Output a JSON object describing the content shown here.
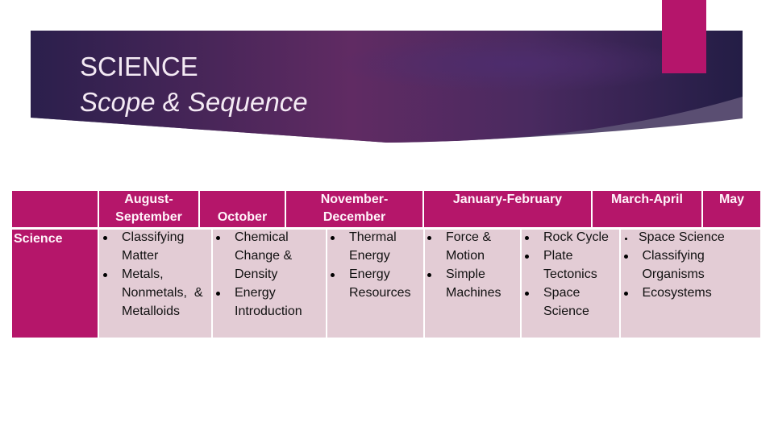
{
  "slide": {
    "title": "SCIENCE",
    "subtitle": "Scope & Sequence",
    "colors": {
      "banner_dark": "#2a1f4a",
      "banner_mid": "#5e2a62",
      "accent": "#b5156b",
      "header_fill": "#b5166a",
      "body_fill": "#e3ccd5"
    }
  },
  "table": {
    "headers": [
      {
        "lines": [
          "",
          ""
        ]
      },
      {
        "lines": [
          "August-",
          "September"
        ]
      },
      {
        "lines": [
          "",
          "October"
        ]
      },
      {
        "lines": [
          "November-",
          "December"
        ]
      },
      {
        "lines": [
          "January-February",
          ""
        ]
      },
      {
        "lines": [
          "March-April",
          ""
        ]
      },
      {
        "lines": [
          "May",
          ""
        ]
      }
    ],
    "row_label": "Science",
    "columns": [
      {
        "items": [
          [
            "Classifying",
            "Matter"
          ],
          [
            "Metals,",
            "Nonmetals,  &",
            "Metalloids"
          ]
        ]
      },
      {
        "items": [
          [
            "Chemical",
            "Change &",
            "Density"
          ],
          [
            "Energy",
            "Introduction"
          ]
        ]
      },
      {
        "items": [
          [
            "Thermal",
            "Energy"
          ],
          [
            "Energy",
            "Resources"
          ]
        ]
      },
      {
        "items": [
          [
            "Force &",
            "Motion"
          ],
          [
            "Simple",
            "Machines"
          ]
        ]
      },
      {
        "items": [
          [
            "Rock Cycle"
          ],
          [
            "Plate",
            "Tectonics"
          ],
          [
            "Space",
            "Science"
          ]
        ]
      },
      {
        "items": [
          [
            "Space Science"
          ],
          [
            " Classifying",
            " Organisms"
          ],
          [
            " Ecosystems"
          ]
        ]
      }
    ]
  }
}
